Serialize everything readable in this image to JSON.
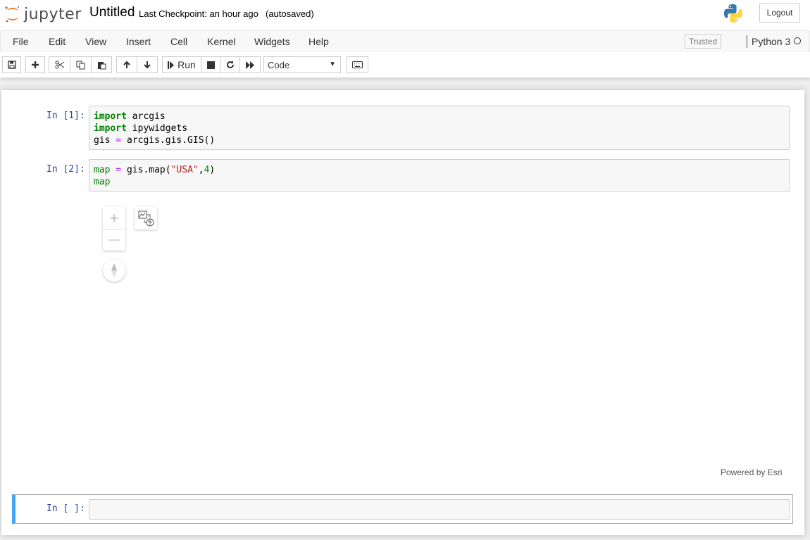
{
  "header": {
    "logo_text": "jupyter",
    "notebook_name": "Untitled",
    "checkpoint": "Last Checkpoint: an hour ago",
    "autosave": "(autosaved)",
    "logout_label": "Logout"
  },
  "menubar": {
    "items": [
      "File",
      "Edit",
      "View",
      "Insert",
      "Cell",
      "Kernel",
      "Widgets",
      "Help"
    ],
    "trusted_label": "Trusted",
    "kernel_name": "Python 3"
  },
  "toolbar": {
    "run_label": "Run",
    "cell_type": "Code",
    "icons": [
      "save-icon",
      "plus-icon",
      "cut-icon",
      "copy-icon",
      "paste-icon",
      "arrow-up-icon",
      "arrow-down-icon",
      "step-forward-icon",
      "stop-icon",
      "restart-icon",
      "fast-forward-icon",
      "keyboard-icon"
    ]
  },
  "cells": [
    {
      "prompt": "In [1]:",
      "lines": [
        [
          {
            "t": "import",
            "c": "kw"
          },
          {
            "t": " arcgis",
            "c": "var"
          }
        ],
        [
          {
            "t": "import",
            "c": "kw"
          },
          {
            "t": " ipywidgets",
            "c": "var"
          }
        ],
        [
          {
            "t": "gis ",
            "c": "var"
          },
          {
            "t": "=",
            "c": "op"
          },
          {
            "t": " arcgis.gis.GIS()",
            "c": "var"
          }
        ]
      ]
    },
    {
      "prompt": "In [2]:",
      "lines": [
        [
          {
            "t": "map",
            "c": "map-name"
          },
          {
            "t": " ",
            "c": "var"
          },
          {
            "t": "=",
            "c": "op"
          },
          {
            "t": " gis.map(",
            "c": "var"
          },
          {
            "t": "\"USA\"",
            "c": "str"
          },
          {
            "t": ",",
            "c": "var"
          },
          {
            "t": "4",
            "c": "num"
          },
          {
            "t": ")",
            "c": "var"
          }
        ],
        [
          {
            "t": "map",
            "c": "map-name"
          }
        ]
      ]
    },
    {
      "prompt": "In [ ]:",
      "lines": []
    }
  ],
  "map_widget": {
    "zoom_in": "+",
    "zoom_out": "—",
    "attribution": "Powered by Esri"
  },
  "colors": {
    "prompt": "#303f9f",
    "keyword": "#008000",
    "operator": "#aa22ff",
    "string": "#ba2121",
    "active_cell_border": "#42a5f5"
  }
}
